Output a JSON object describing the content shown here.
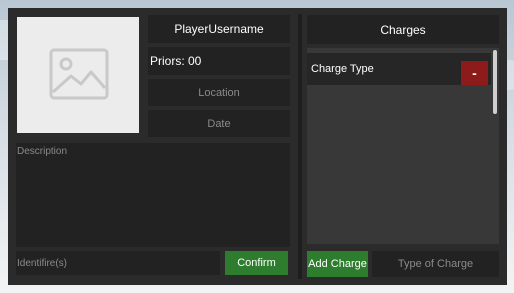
{
  "profile": {
    "photo_icon": "image-placeholder-icon",
    "username": "PlayerUsername",
    "priors": "Priors: 00",
    "location_placeholder": "Location",
    "date_placeholder": "Date",
    "description_placeholder": "Description",
    "identifier_placeholder": "Identifire(s)",
    "confirm_label": "Confirm"
  },
  "charges": {
    "title": "Charges",
    "items": [
      {
        "label": "Charge Type",
        "remove_label": "-"
      }
    ],
    "add_label": "Add Charge",
    "type_placeholder": "Type of Charge"
  },
  "colors": {
    "panel": "#2b2b2b",
    "field": "#222222",
    "green": "#2e7d2e",
    "red": "#8e1b1b"
  }
}
